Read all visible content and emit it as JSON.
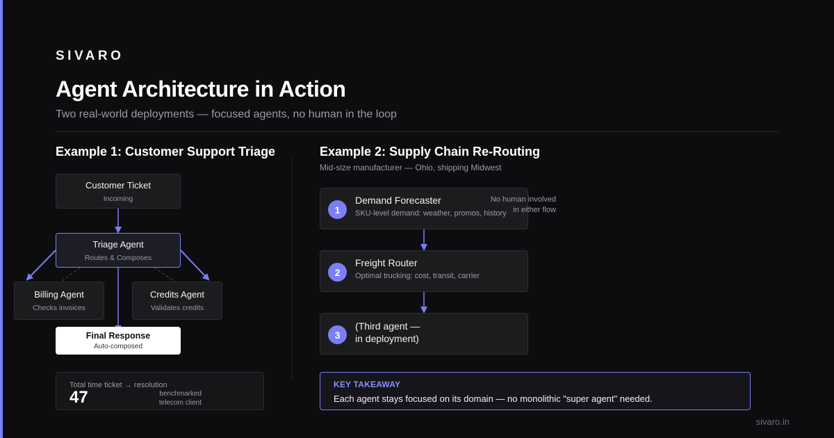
{
  "brand": "SIVARO",
  "title": "Agent Architecture in Action",
  "subtitle": "Two real-world deployments — focused agents, no human in the loop",
  "example1": {
    "heading": "Example 1: Customer Support Triage",
    "nodes": {
      "ticket": {
        "title": "Customer Ticket",
        "sub": "Incoming"
      },
      "triage": {
        "title": "Triage Agent",
        "sub": "Routes & Composes"
      },
      "billing": {
        "title": "Billing Agent",
        "sub": "Checks invoices"
      },
      "credits": {
        "title": "Credits Agent",
        "sub": "Validates credits"
      },
      "final": {
        "title": "Final Response",
        "sub": "Auto-composed"
      }
    },
    "stat": {
      "label": "Total time ticket → resolution",
      "value": "47",
      "note_line1": "benchmarked",
      "note_line2": "telecom client"
    }
  },
  "example2": {
    "heading": "Example 2: Supply Chain Re-Routing",
    "sub": "Mid-size manufacturer — Ohio, shipping Midwest",
    "steps": [
      {
        "num": "1",
        "title": "Demand Forecaster",
        "desc": "SKU-level demand: weather, promos, history"
      },
      {
        "num": "2",
        "title": "Freight Router",
        "desc": "Optimal trucking: cost, transit, carrier"
      },
      {
        "num": "3",
        "line1": "(Third agent —",
        "line2": "in deployment)"
      }
    ],
    "note_line1": "No human involved",
    "note_line2": "in either flow"
  },
  "takeaway": {
    "label": "KEY TAKEAWAY",
    "text": "Each agent stays focused on its domain — no monolithic \"super agent\" needed."
  },
  "footer_url": "sivaro.in",
  "colors": {
    "accent": "#7b7ff5",
    "background": "#0d0d0f",
    "card": "#1c1c1f"
  }
}
